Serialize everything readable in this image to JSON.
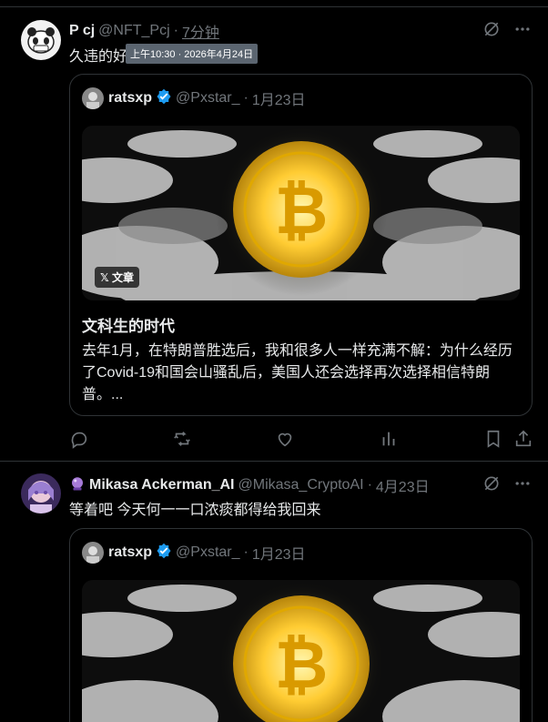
{
  "post1": {
    "name": "P cj",
    "handle": "@NFT_Pcj",
    "sep": "·",
    "time": "7分钟",
    "text": "久违的好",
    "tooltip": "上午10:30 · 2026年4月24日",
    "quote": {
      "name": "ratsxp",
      "handle": "@Pxstar_",
      "sep": "·",
      "date": "1月23日",
      "badge": "文章",
      "title": "文科生的时代",
      "body": "去年1月，在特朗普胜选后，我和很多人一样充满不解：为什么经历了Covid-19和国会山骚乱后，美国人还会选择再次选择相信特朗普。..."
    }
  },
  "post2": {
    "name": "Mikasa Ackerman_AI",
    "handle": "@Mikasa_CryptoAI",
    "sep": "·",
    "time": "4月23日",
    "text": "等着吧 今天何一一口浓痰都得给我回来",
    "quote": {
      "name": "ratsxp",
      "handle": "@Pxstar_",
      "sep": "·",
      "date": "1月23日"
    }
  },
  "colors": {
    "accent": "#1d9bf0",
    "muted": "#71767b",
    "text": "#e7e9ea",
    "border": "#2f3336"
  },
  "icons": [
    "grok-icon",
    "more-icon",
    "reply-icon",
    "repost-icon",
    "like-icon",
    "views-icon",
    "bookmark-icon",
    "share-icon",
    "verified-icon"
  ]
}
